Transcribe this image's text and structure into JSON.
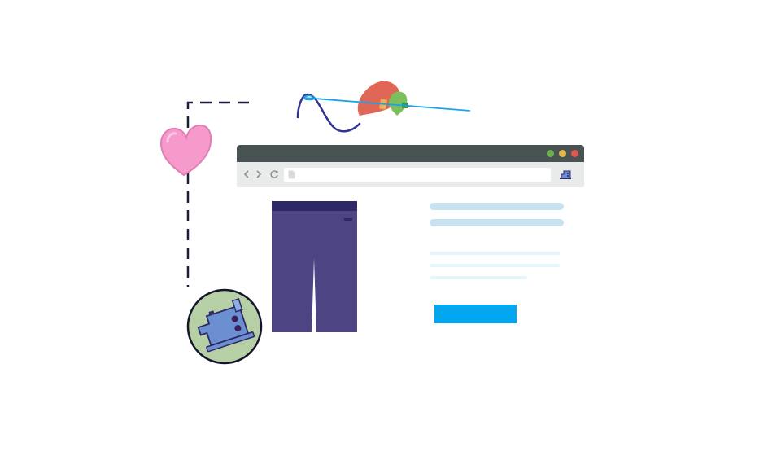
{
  "colors": {
    "titlebar": "#4a5354",
    "toolbar": "#e9eaea",
    "dot_green": "#6ab04c",
    "dot_yellow": "#e0b84a",
    "dot_red": "#e0554d",
    "pants": "#4c4483",
    "pants_waistband": "#2e2866",
    "skeleton_heading": "#c9e2ef",
    "skeleton_line": "#e6f4fb",
    "cta": "#05a6f0",
    "heart_pink": "#f59acb",
    "heart_red": "#e06655",
    "heart_green": "#7dbf5c",
    "badge_bg": "#b6cfa4",
    "machine_blue": "#6b8fd1",
    "thread": "#2f3391",
    "needle": "#1aa3e8"
  },
  "icons": {
    "back": "chevron-left-icon",
    "forward": "chevron-right-icon",
    "reload": "reload-icon",
    "page": "page-icon",
    "extension": "sewing-machine-icon"
  }
}
